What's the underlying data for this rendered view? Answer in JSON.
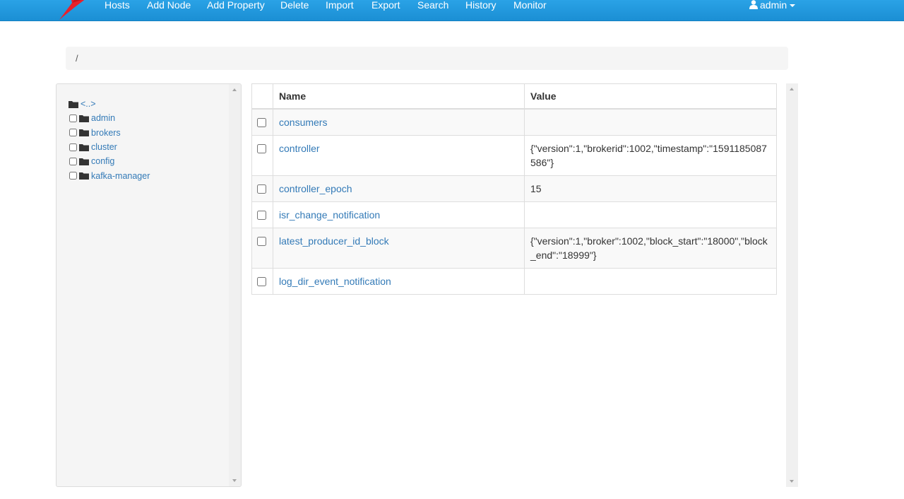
{
  "nav": {
    "items": [
      {
        "label": "Hosts"
      },
      {
        "label": "Add Node"
      },
      {
        "label": "Add Property"
      },
      {
        "label": "Delete"
      },
      {
        "label": "Import"
      },
      {
        "label": "Export"
      },
      {
        "label": "Search"
      },
      {
        "label": "History"
      },
      {
        "label": "Monitor"
      }
    ],
    "user_label": "admin",
    "brand_color": "#e8212b",
    "bar_color": "#2aa2e6"
  },
  "breadcrumb": {
    "path": "/"
  },
  "tree": {
    "parent_label": "<..>",
    "items": [
      {
        "label": "admin"
      },
      {
        "label": "brokers"
      },
      {
        "label": "cluster"
      },
      {
        "label": "config"
      },
      {
        "label": "kafka-manager"
      }
    ],
    "icon": "folder-icon"
  },
  "table": {
    "headers": {
      "name": "Name",
      "value": "Value"
    },
    "rows": [
      {
        "name": "consumers",
        "value": ""
      },
      {
        "name": "controller",
        "value": "{\"version\":1,\"brokerid\":1002,\"timestamp\":\"1591185087586\"}"
      },
      {
        "name": "controller_epoch",
        "value": "15"
      },
      {
        "name": "isr_change_notification",
        "value": ""
      },
      {
        "name": "latest_producer_id_block",
        "value": "{\"version\":1,\"broker\":1002,\"block_start\":\"18000\",\"block_end\":\"18999\"}"
      },
      {
        "name": "log_dir_event_notification",
        "value": ""
      }
    ]
  }
}
